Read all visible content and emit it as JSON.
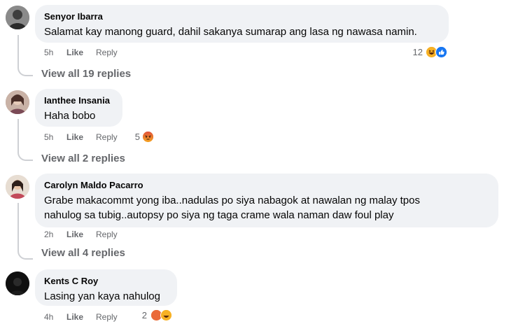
{
  "comments": [
    {
      "author": "Senyor Ibarra",
      "text": "Salamat kay manong guard, dahil sakanya sumarap ang lasa ng nawasa namin.",
      "time": "5h",
      "like": "Like",
      "reply": "Reply",
      "reaction_count": "12",
      "reactions": [
        "haha-icon",
        "like-icon"
      ],
      "view_replies": "View all 19 replies"
    },
    {
      "author": "Ianthee Insania",
      "text": "Haha bobo",
      "time": "5h",
      "like": "Like",
      "reply": "Reply",
      "reaction_count": "5",
      "reactions": [
        "angry-icon"
      ],
      "view_replies": "View all 2 replies"
    },
    {
      "author": "Carolyn Maldo Pacarro",
      "text": "Grabe makacommt yong iba..nadulas po siya nabagok at nawalan ng malay tpos\nnahulog sa tubig..autopsy po siya ng taga crame wala naman daw foul play",
      "time": "2h",
      "like": "Like",
      "reply": "Reply",
      "view_replies": "View all 4 replies"
    },
    {
      "author": "Kents C Roy",
      "text": "Lasing yan kaya nahulog",
      "time": "4h",
      "like": "Like",
      "reply": "Reply",
      "reaction_count": "2",
      "reactions": [
        "angry-icon",
        "haha-icon"
      ]
    }
  ],
  "colors": {
    "bubble": "#f0f2f5",
    "secondary_text": "#65676b",
    "like_blue": "#1877f2",
    "haha_yellow": "#f7b125",
    "angry_red": "#e9710f"
  }
}
